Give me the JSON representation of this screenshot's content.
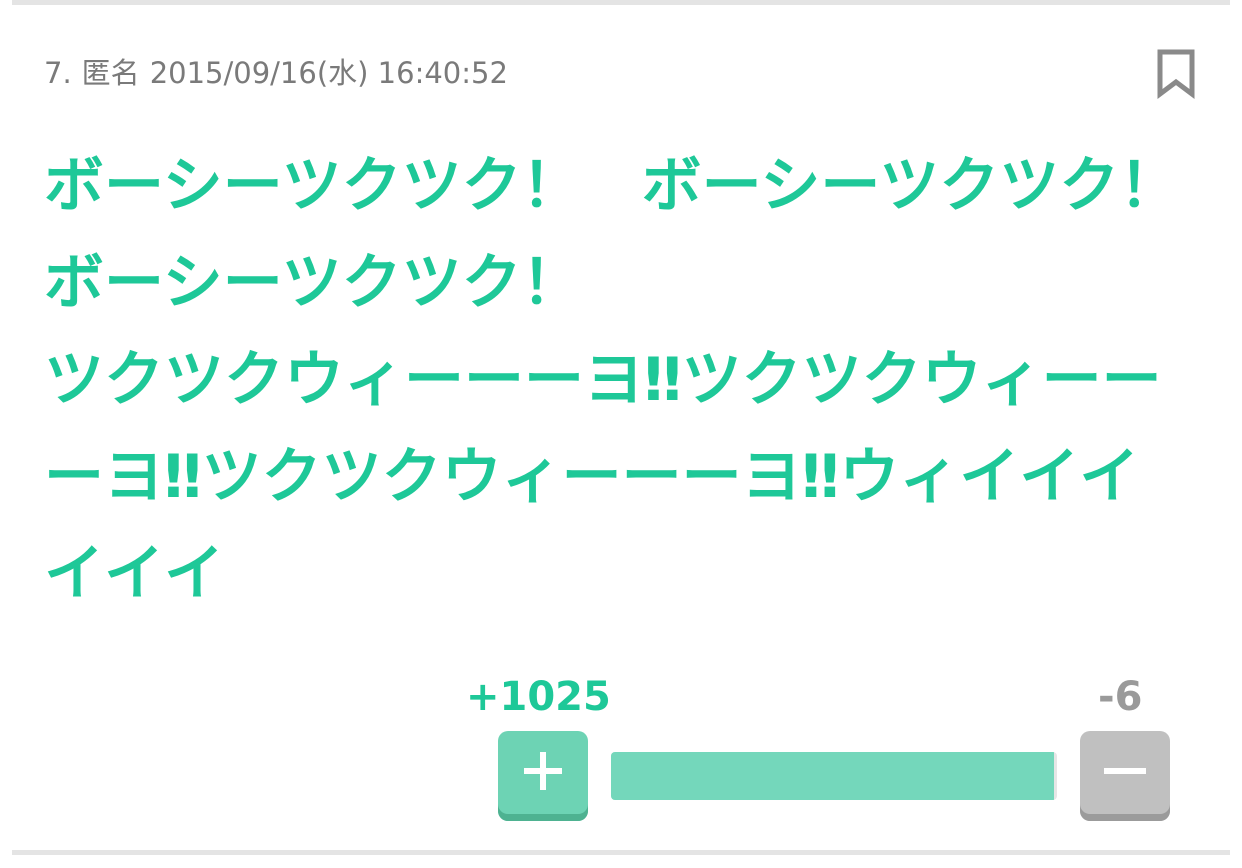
{
  "comment": {
    "number": "7.",
    "author": "匿名",
    "date": "2015/09/16(水) 16:40:52",
    "body": "ボーシーツクツク！　ボーシーツクツク！　ボーシーツクツク！\nツクツクウィーーーヨ‼ツクツクウィーーーヨ‼ツクツクウィーーーヨ‼ウィイイイイイイ"
  },
  "votes": {
    "plus_label": "+1025",
    "minus_label": "-6",
    "plus": 1025,
    "minus": 6,
    "plus_ratio": 0.9942
  },
  "icons": {
    "bookmark": "bookmark-icon",
    "plus": "plus-icon",
    "minus": "minus-icon"
  },
  "colors": {
    "accent": "#1ec898",
    "bar_fill": "#74d7bb",
    "plus_button": "#6dd3b4",
    "minus_button": "#c0c0c0",
    "meta_text": "#7a7a7a"
  }
}
